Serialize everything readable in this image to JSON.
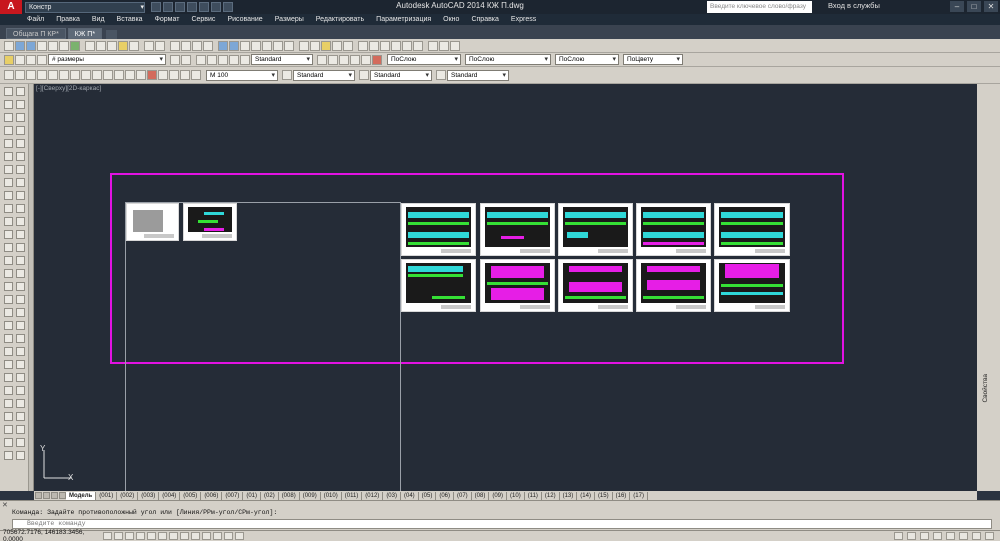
{
  "titlebar": {
    "app_logo": "A",
    "workspace": "Констр",
    "title": "Autodesk AutoCAD 2014    КЖ П.dwg",
    "search_placeholder": "Введите ключевое слово/фразу",
    "signin": "Вход в службы"
  },
  "menu": [
    "Файл",
    "Правка",
    "Вид",
    "Вставка",
    "Формат",
    "Сервис",
    "Рисование",
    "Размеры",
    "Редактировать",
    "Параметризация",
    "Окно",
    "Справка",
    "Express"
  ],
  "doc_tabs": [
    {
      "label": "Общага П КР*",
      "active": false
    },
    {
      "label": "КЖ П*",
      "active": true
    }
  ],
  "toolbars": {
    "layer_combo": "# размеры",
    "dimstyle_combo": "Standard",
    "color_combo": "ПоСлою",
    "linetype_combo": "ПоСлою",
    "lineweight_combo": "ПоСлою",
    "plotstyle_combo": "ПоЦвету",
    "scale_combo": "М 100",
    "textstyle_combo": "Standard",
    "tablestyle_combo": "Standard",
    "mleader_combo": "Standard"
  },
  "viewport_label": "[-][Сверху][2D-каркас]",
  "right_palette_label": "Свойства",
  "ucs": {
    "y": "Y",
    "x": "X"
  },
  "layout_tabs": [
    "Модель",
    "(001)",
    "(002)",
    "(003)",
    "(004)",
    "(005)",
    "(006)",
    "(007)",
    "(01)",
    "(02)",
    "(008)",
    "(009)",
    "(010)",
    "(011)",
    "(012)",
    "(03)",
    "(04)",
    "(05)",
    "(06)",
    "(07)",
    "(08)",
    "(09)",
    "(10)",
    "(11)",
    "(12)",
    "(13)",
    "(14)",
    "(15)",
    "(16)",
    "(17)"
  ],
  "command": {
    "history": "Команда: Задайте противоположный угол или [Линия/РРм-угол/СРм-угол]:",
    "placeholder": "Введите команду"
  },
  "status": {
    "coords": "705672.7176, 146183.3456, 0.0000"
  },
  "colors": {
    "highlight": "#e212e2",
    "canvas_bg": "#252c37",
    "cyan": "#2fd8d8",
    "magenta": "#e61ee6",
    "green": "#35e035"
  }
}
